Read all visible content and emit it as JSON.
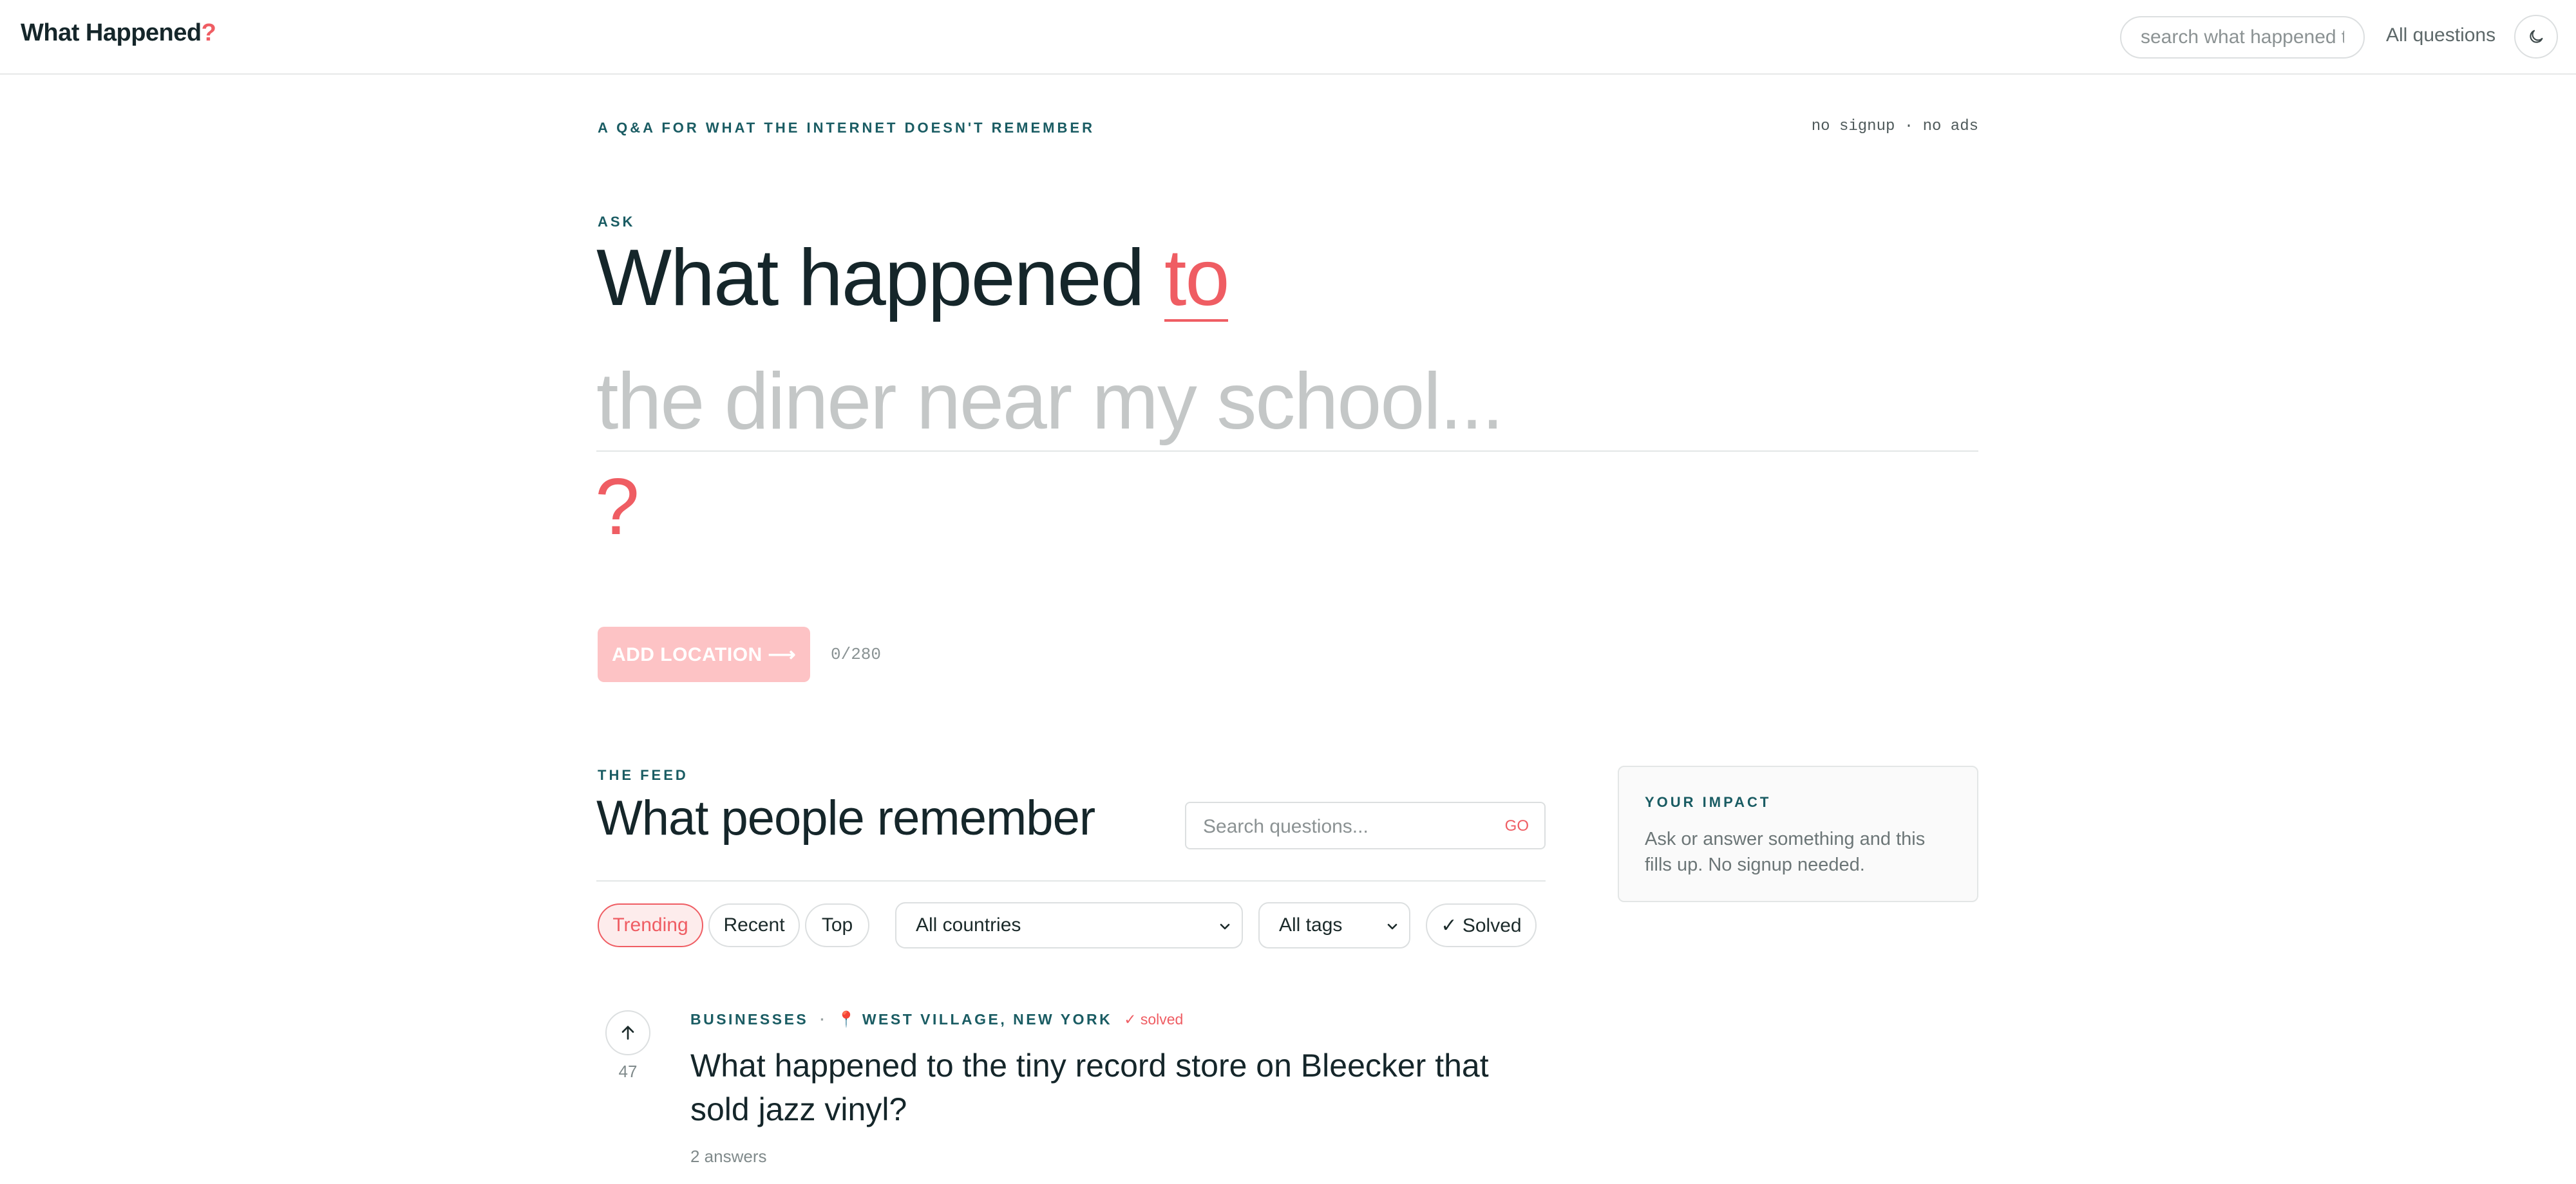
{
  "brand": {
    "name": "What Happened",
    "mark": "?"
  },
  "topbar": {
    "search_placeholder": "search what happened t",
    "all_questions": "All questions",
    "theme_icon": "moon-icon"
  },
  "hero": {
    "tagline": "A Q&A FOR WHAT THE INTERNET DOESN'T REMEMBER",
    "meta": "no signup · no ads",
    "ask_label": "ASK",
    "headline": "What happened",
    "headline_accent": "to",
    "subject_placeholder": "the diner near my school...",
    "question_mark": "?",
    "add_location_label": "ADD LOCATION ⟶",
    "char_counter": "0/280"
  },
  "feed": {
    "kicker": "THE FEED",
    "title": "What people remember",
    "search_placeholder": "Search questions...",
    "search_go": "GO",
    "sort_tabs": [
      {
        "label": "Trending",
        "active": true
      },
      {
        "label": "Recent",
        "active": false
      },
      {
        "label": "Top",
        "active": false
      }
    ],
    "country_filter": "All countries",
    "tag_filter": "All tags",
    "solved_filter": "✓ Solved"
  },
  "impact": {
    "kicker": "YOUR IMPACT",
    "text": "Ask or answer something and this fills up. No signup needed."
  },
  "questions": [
    {
      "votes": "47",
      "category": "BUSINESSES",
      "location": "WEST VILLAGE, NEW YORK",
      "status": "✓ solved",
      "title": "What happened to the tiny record store on Bleecker that sold jazz vinyl?",
      "answers": "2 answers"
    }
  ],
  "colors": {
    "accent": "#ef5d63",
    "teal": "#1a5c63",
    "ink": "#15262a",
    "button_disabled": "#fdc3c5"
  }
}
